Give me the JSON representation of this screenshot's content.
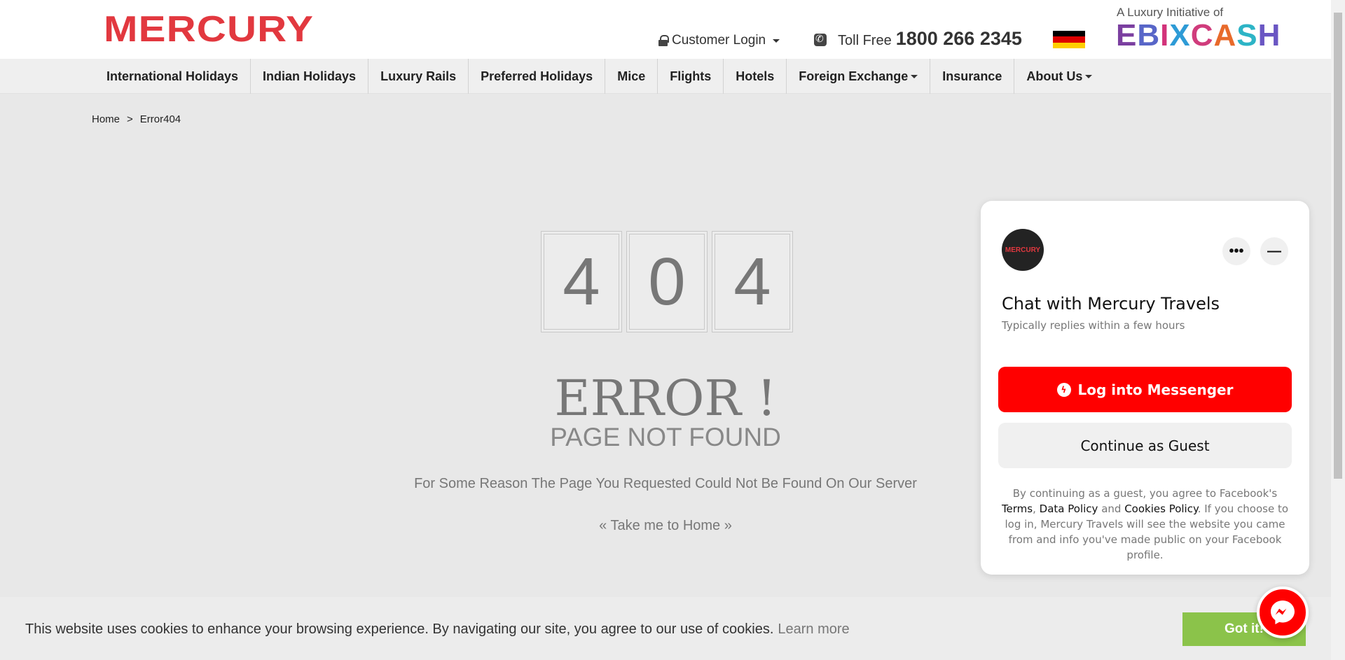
{
  "header": {
    "logo": "MERCURY",
    "customer_login": "Customer Login",
    "toll_label": "Toll Free",
    "toll_number": "1800 266 2345",
    "initiative": "A Luxury Initiative of",
    "ebix_logo": "EBIXCASH"
  },
  "nav": {
    "items": [
      "International Holidays",
      "Indian Holidays",
      "Luxury Rails",
      "Preferred Holidays",
      "Mice",
      "Flights",
      "Hotels",
      "Foreign Exchange",
      "Insurance",
      "About Us"
    ]
  },
  "breadcrumb": {
    "home": "Home",
    "sep": ">",
    "current": "Error404"
  },
  "error": {
    "d1": "4",
    "d2": "0",
    "d3": "4",
    "title": "ERROR !",
    "subtitle": "PAGE NOT FOUND",
    "message": "For Some Reason The Page You Requested Could Not Be Found On Our Server",
    "home_link": "« Take me to Home »"
  },
  "chat": {
    "avatar_text": "MERCURY",
    "title": "Chat with Mercury Travels",
    "subtitle": "Typically replies within a few hours",
    "login_label": "Log into Messenger",
    "guest_label": "Continue as Guest",
    "legal_1": "By continuing as a guest, you agree to Facebook's",
    "terms": "Terms",
    "data_policy": "Data Policy",
    "and": "and",
    "cookies_policy": "Cookies Policy",
    "legal_2": ". If you choose to log in, Mercury Travels will see the website you came from and info you've made public on your Facebook profile."
  },
  "cookie": {
    "text": "This website uses cookies to enhance your browsing experience. By navigating our site, you agree to our use of cookies.",
    "learn_more": "Learn more",
    "button": "Got it!"
  },
  "colors": {
    "brand_red": "#e2383f",
    "messenger_red": "#ff0000",
    "cookie_green": "#8bc34a"
  }
}
